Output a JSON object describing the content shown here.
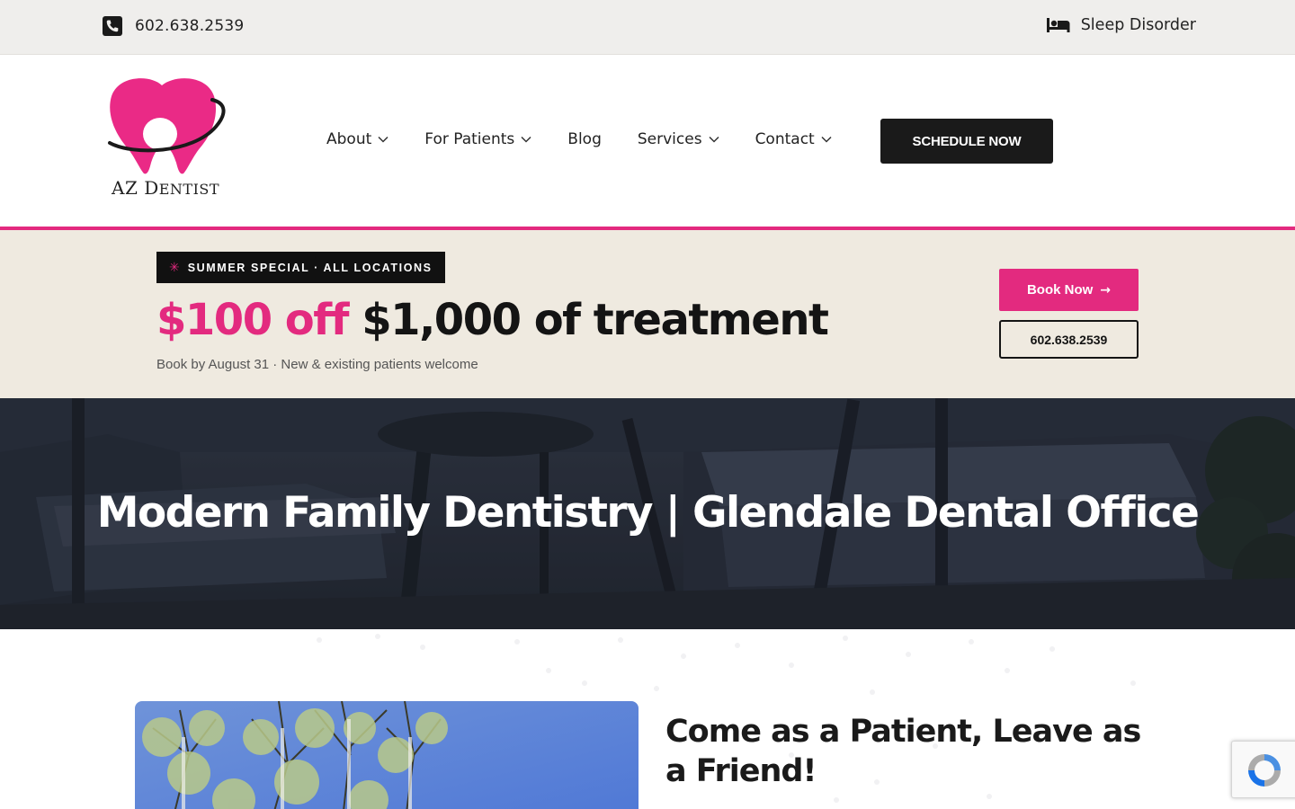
{
  "topbar": {
    "phone": "602.638.2539",
    "sleep_link": "Sleep Disorder",
    "phone_icon": "phone-icon",
    "sleep_icon": "bed-icon"
  },
  "header": {
    "logo_text_big": "AZ D",
    "logo_text_small": "ENTIST",
    "nav": [
      {
        "label": "About",
        "has_dropdown": true
      },
      {
        "label": "For Patients",
        "has_dropdown": true
      },
      {
        "label": "Blog",
        "has_dropdown": false
      },
      {
        "label": "Services",
        "has_dropdown": true
      },
      {
        "label": "Contact",
        "has_dropdown": true
      }
    ],
    "cta": "SCHEDULE NOW"
  },
  "promo": {
    "badge_icon": "✳",
    "badge": "SUMMER SPECIAL · ALL LOCATIONS",
    "headline_pink": "$100 off",
    "headline_dark": "$1,000 of treatment",
    "subtext": "Book by August 31 · New & existing patients welcome",
    "book_label": "Book Now",
    "book_arrow": "→",
    "call_label": "602.638.2539"
  },
  "hero": {
    "title": "Modern Family Dentistry | Glendale Dental Office"
  },
  "intro": {
    "heading": "Come as a Patient, Leave as a Friend!"
  },
  "colors": {
    "brand_pink": "#e32a7f",
    "dark": "#141414",
    "promo_bg": "#efeae0",
    "topbar_bg": "#efeeec"
  }
}
